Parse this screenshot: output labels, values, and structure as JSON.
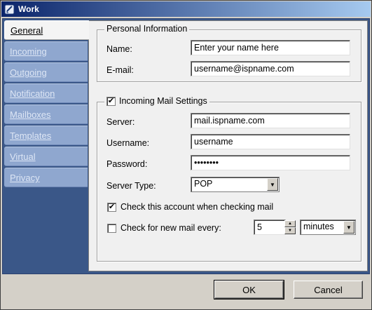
{
  "window": {
    "title": "Work"
  },
  "tabs": [
    {
      "label": "General"
    },
    {
      "label": "Incoming"
    },
    {
      "label": "Outgoing"
    },
    {
      "label": "Notification"
    },
    {
      "label": "Mailboxes"
    },
    {
      "label": "Templates"
    },
    {
      "label": "Virtual"
    },
    {
      "label": "Privacy"
    }
  ],
  "personal": {
    "title": "Personal Information",
    "name_label": "Name:",
    "name_value": "Enter your name here",
    "email_label": "E-mail:",
    "email_value": "username@ispname.com"
  },
  "incoming": {
    "title": "Incoming Mail Settings",
    "enabled": true,
    "server_label": "Server:",
    "server_value": "mail.ispname.com",
    "username_label": "Username:",
    "username_value": "username",
    "password_label": "Password:",
    "password_value": "••••••••",
    "server_type_label": "Server Type:",
    "server_type_value": "POP",
    "check_account_label": "Check this account when checking mail",
    "check_account_checked": true,
    "check_every_label": "Check for new mail every:",
    "check_every_checked": false,
    "interval_value": "5",
    "interval_unit": "minutes"
  },
  "buttons": {
    "ok": "OK",
    "cancel": "Cancel"
  },
  "colors": {
    "titlebar": "#0a246a",
    "sidebar": "#3a5788",
    "tab": "#8fa7cf"
  }
}
